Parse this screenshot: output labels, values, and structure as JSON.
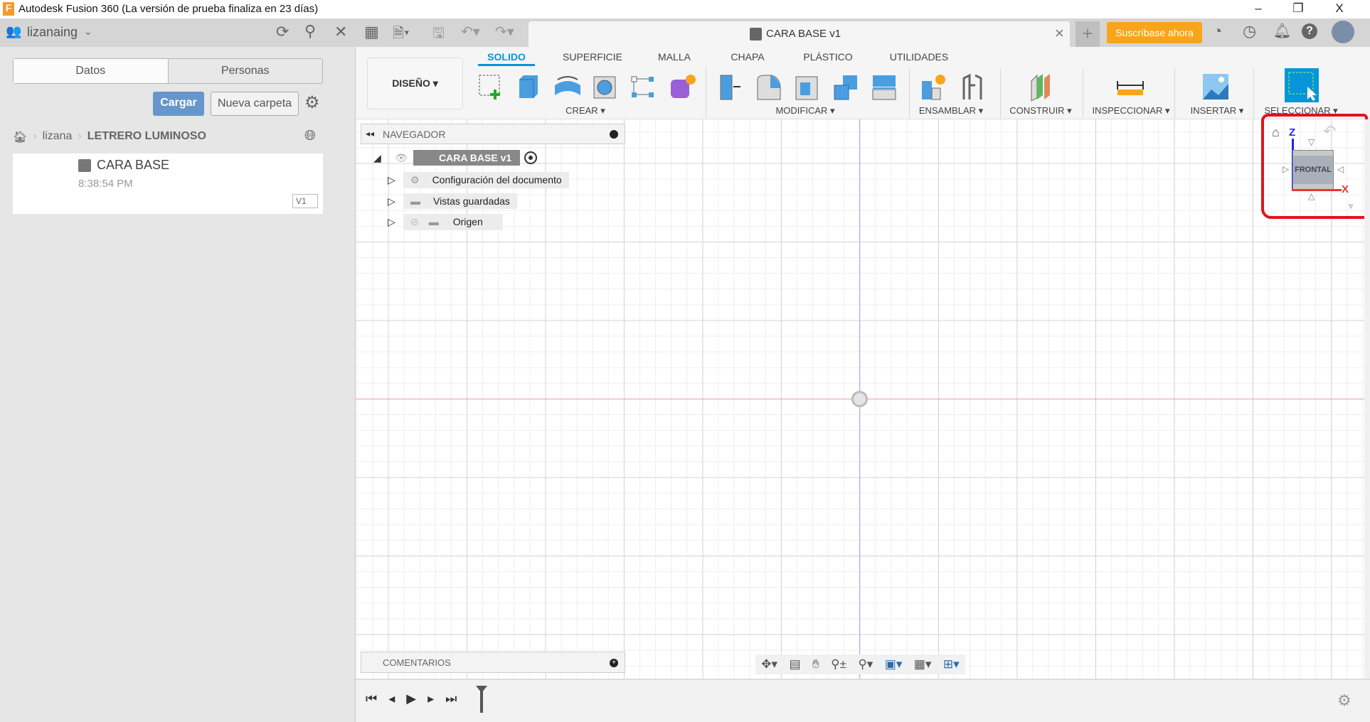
{
  "window": {
    "title": "Autodesk Fusion 360 (La versión de prueba finaliza en 23 días)",
    "minimize": "–",
    "restore": "❐",
    "close": "X"
  },
  "data_panel": {
    "user": "lizanaing",
    "tabs": [
      "Datos",
      "Personas"
    ],
    "upload_label": "Cargar",
    "new_folder_label": "Nueva carpeta",
    "breadcrumb": [
      "lizana",
      "LETRERO LUMINOSO"
    ],
    "files": [
      {
        "name": "CARA BASE",
        "time": "8:38:54 PM",
        "version": "V1"
      }
    ]
  },
  "document": {
    "title": "CARA BASE v1",
    "close": "×",
    "new_tab": "+"
  },
  "subscribe_label": "Suscríbase ahora",
  "workspace": "DISEÑO",
  "ribbon_tabs": [
    {
      "label": "SOLIDO",
      "active": true
    },
    {
      "label": "SUPERFICIE"
    },
    {
      "label": "MALLA"
    },
    {
      "label": "CHAPA"
    },
    {
      "label": "PLÁSTICO"
    },
    {
      "label": "UTILIDADES"
    }
  ],
  "groups": [
    "CREAR",
    "MODIFICAR",
    "ENSAMBLAR",
    "CONSTRUIR",
    "INSPECCIONAR",
    "INSERTAR",
    "SELECCIONAR"
  ],
  "navigator": {
    "title": "NAVEGADOR",
    "root": "CARA BASE v1",
    "items": [
      "Configuración del documento",
      "Vistas guardadas",
      "Origen"
    ]
  },
  "comments": {
    "title": "COMENTARIOS"
  },
  "viewcube": {
    "face": "FRONTAL",
    "axis_z": "Z",
    "axis_x": "X"
  },
  "colors": {
    "accent": "#0696d7",
    "subscribe": "#f8a51b",
    "upload": "#6696cb",
    "x_axis": "#e33",
    "z_axis": "#22f",
    "annotation": "#e0141c"
  }
}
